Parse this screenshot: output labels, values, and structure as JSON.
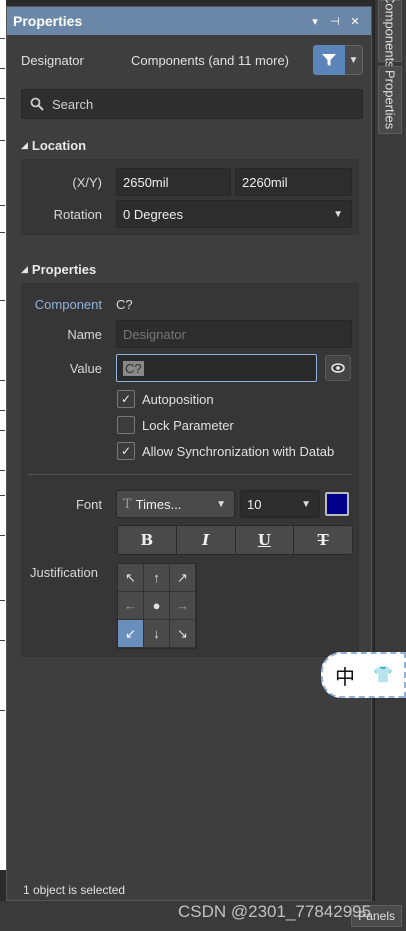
{
  "panel": {
    "title": "Properties",
    "title_buttons": [
      "▾",
      "⊣",
      "✕"
    ],
    "designator_label": "Designator",
    "designator_value": "Components (and 11 more)",
    "search_placeholder": "Search"
  },
  "location": {
    "header": "Location",
    "xy_label": "(X/Y)",
    "x_value": "2650mil",
    "y_value": "2260mil",
    "rotation_label": "Rotation",
    "rotation_value": "0 Degrees"
  },
  "properties": {
    "header": "Properties",
    "component_label": "Component",
    "component_value": "C?",
    "name_label": "Name",
    "name_placeholder": "Designator",
    "value_label": "Value",
    "value_value": "C?",
    "autoposition_label": "Autoposition",
    "autoposition_checked": true,
    "lock_label": "Lock Parameter",
    "lock_checked": false,
    "allow_sync_label": "Allow Synchronization with Datab",
    "allow_sync_checked": true,
    "font_label": "Font",
    "font_name": "Times...",
    "font_size": "10",
    "font_color": "#00008b",
    "format_buttons": [
      "B",
      "I",
      "U",
      "T"
    ],
    "justification_label": "Justification",
    "justification_active": "bottom-left"
  },
  "status": "1 object is selected",
  "side_tabs": {
    "components": "Components",
    "properties": "Properties"
  },
  "ime": {
    "char": "中",
    "shirt": "👕"
  },
  "panels_button": "Panels",
  "watermark": "CSDN @2301_77842995"
}
